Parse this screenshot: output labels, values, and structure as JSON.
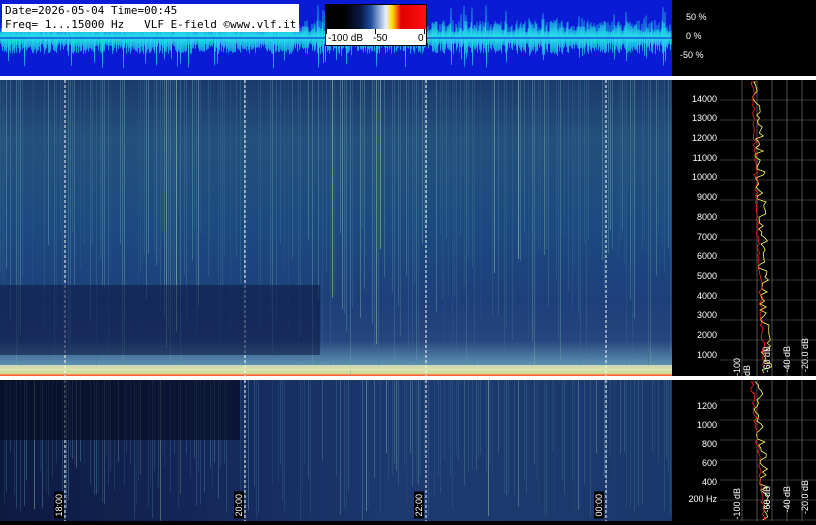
{
  "header": {
    "line1": "Date=2026-05-04 Time=00:45",
    "line2": "Freq= 1...15000 Hz   VLF E-field ©www.vlf.it"
  },
  "color_scale": {
    "labels": [
      "-100 dB",
      "-50",
      "0"
    ]
  },
  "waveform": {
    "percent_labels": [
      "50 %",
      "0 %",
      "-50 %"
    ]
  },
  "spectrogram_upper": {
    "freq_labels": [
      "14000",
      "13000",
      "12000",
      "11000",
      "10000",
      "9000",
      "8000",
      "7000",
      "6000",
      "5000",
      "4000",
      "3000",
      "2000",
      "1000"
    ]
  },
  "spectrogram_lower": {
    "freq_labels": [
      "1200",
      "1000",
      "800",
      "600",
      "400",
      "200 Hz"
    ]
  },
  "time_axis": {
    "labels": [
      "18:00",
      "20:00",
      "22:00",
      "00:00"
    ]
  },
  "profile": {
    "db_labels": [
      "-100 dB",
      "-60 dB",
      "-40 dB",
      "-20.0 dB"
    ]
  },
  "colors": {
    "waveform_bg": "#0a1bd6",
    "waveform_trace": "#25d8e8",
    "profile_red": "#ff2020",
    "profile_yellow": "#ffff60"
  }
}
